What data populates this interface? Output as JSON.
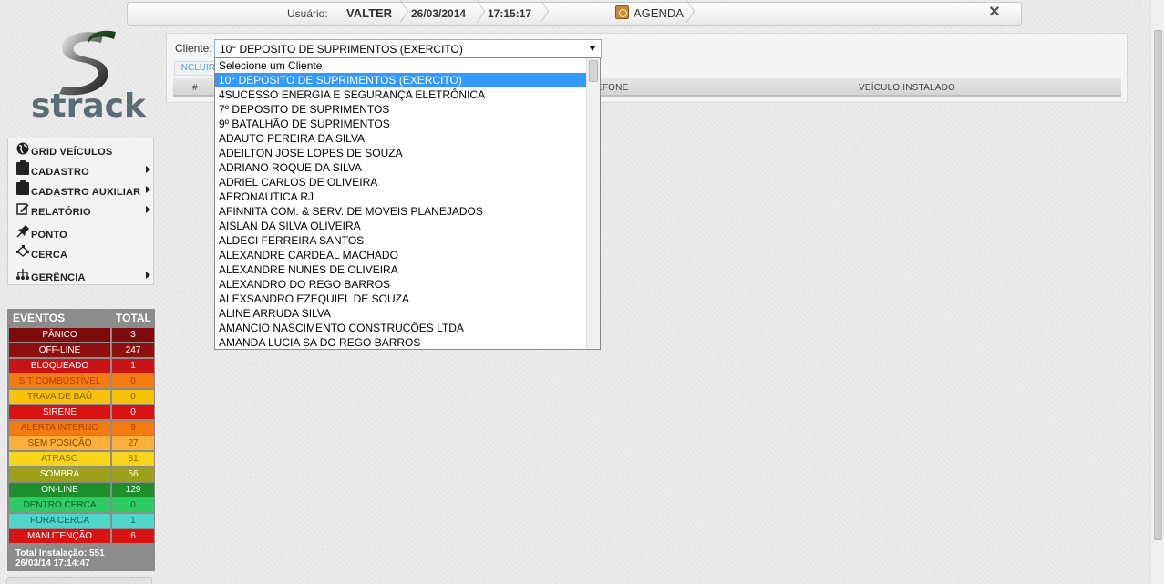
{
  "topbar": {
    "user_label": "Usuário:",
    "user_name": "VALTER",
    "date": "26/03/2014",
    "time": "17:15:17",
    "agenda_label": "AGENDA",
    "close_symbol": "✕"
  },
  "logo": {
    "text": "strack",
    "icon": "strack-s-logo"
  },
  "menu": {
    "items": [
      {
        "label": "GRID VEÍCULOS",
        "icon": "globe-icon",
        "has_submenu": false
      },
      {
        "label": "CADASTRO",
        "icon": "clipboard-icon",
        "has_submenu": true
      },
      {
        "label": "CADASTRO AUXILIAR",
        "icon": "clipboard-icon",
        "has_submenu": true
      },
      {
        "label": "RELATÓRIO",
        "icon": "edit-icon",
        "has_submenu": true
      },
      {
        "label": "PONTO",
        "icon": "pin-icon",
        "has_submenu": false
      },
      {
        "label": "CERCA",
        "icon": "fence-icon",
        "has_submenu": false
      },
      {
        "label": "GERÊNCIA",
        "icon": "hierarchy-icon",
        "has_submenu": true
      }
    ]
  },
  "events": {
    "header_name": "EVENTOS",
    "header_total": "TOTAL",
    "rows": [
      {
        "name": "PÂNICO",
        "total": "3",
        "bg": "#7d0b0b",
        "fg": "#ffffff"
      },
      {
        "name": "OFF-LINE",
        "total": "247",
        "bg": "#8f0f0f",
        "fg": "#ffffff"
      },
      {
        "name": "BLOQUEADO",
        "total": "1",
        "bg": "#c81414",
        "fg": "#ffffff"
      },
      {
        "name": "S.T COMBUSTÍVEL",
        "total": "0",
        "bg": "#f47a12",
        "fg": "#b33c00"
      },
      {
        "name": "TRAVA DE BAÚ",
        "total": "0",
        "bg": "#f8c20a",
        "fg": "#8a5d00"
      },
      {
        "name": "SIRENE",
        "total": "0",
        "bg": "#d91212",
        "fg": "#ffffff"
      },
      {
        "name": "ALERTA INTERNO",
        "total": "9",
        "bg": "#f47a12",
        "fg": "#b33c00"
      },
      {
        "name": "SEM POSIÇÃO",
        "total": "27",
        "bg": "#fbb03b",
        "fg": "#8a4a00"
      },
      {
        "name": "ATRASO",
        "total": "81",
        "bg": "#f8d41a",
        "fg": "#8a6d00"
      },
      {
        "name": "SOMBRA",
        "total": "56",
        "bg": "#9da11a",
        "fg": "#ffffff"
      },
      {
        "name": "ON-LINE",
        "total": "129",
        "bg": "#1f8f2b",
        "fg": "#ffffff"
      },
      {
        "name": "DENTRO CERCA",
        "total": "0",
        "bg": "#2ccc63",
        "fg": "#0d5c28"
      },
      {
        "name": "FORA CERCA",
        "total": "1",
        "bg": "#4dd6c9",
        "fg": "#11665e"
      },
      {
        "name": "MANUTENÇÃO",
        "total": "6",
        "bg": "#d61414",
        "fg": "#ffffff"
      }
    ],
    "footer_line1": "Total Instalação: 551",
    "footer_line2": "26/03/14 17:14:47"
  },
  "main": {
    "cliente_label": "Cliente:",
    "cliente_selected": "10° DEPOSITO DE SUPRIMENTOS (EXERCITO)",
    "incluir_label": "INCLUIR",
    "table_headers": {
      "hash": "#",
      "telefone": "EFONE",
      "veiculo": "VEÍCULO INSTALADO"
    }
  },
  "dropdown": {
    "selected_index": 1,
    "options": [
      "Selecione um Cliente",
      "10° DEPOSITO DE SUPRIMENTOS (EXERCITO)",
      "4SUCESSO ENERGIA E SEGURANÇA ELETRÔNICA",
      "7º DEPOSITO DE SUPRIMENTOS",
      "9º BATALHÃO DE SUPRIMENTOS",
      "ADAUTO PEREIRA DA SILVA",
      "ADEILTON JOSE LOPES DE SOUZA",
      "ADRIANO ROQUE DA SILVA",
      "ADRIEL CARLOS DE OLIVEIRA",
      "AERONAUTICA RJ",
      "AFINNITA COM. & SERV. DE MOVEIS PLANEJADOS",
      "AISLAN DA SILVA OLIVEIRA",
      "ALDECI FERREIRA SANTOS",
      "ALEXANDRE CARDEAL MACHADO",
      "ALEXANDRE NUNES DE OLIVEIRA",
      "ALEXANDRO DO REGO BARROS",
      "ALEXSANDRO EZEQUIEL DE SOUZA",
      "ALINE ARRUDA SILVA",
      "AMANCIO NASCIMENTO CONSTRUÇÕES LTDA",
      "AMANDA LUCIA SA DO REGO BARROS"
    ]
  }
}
